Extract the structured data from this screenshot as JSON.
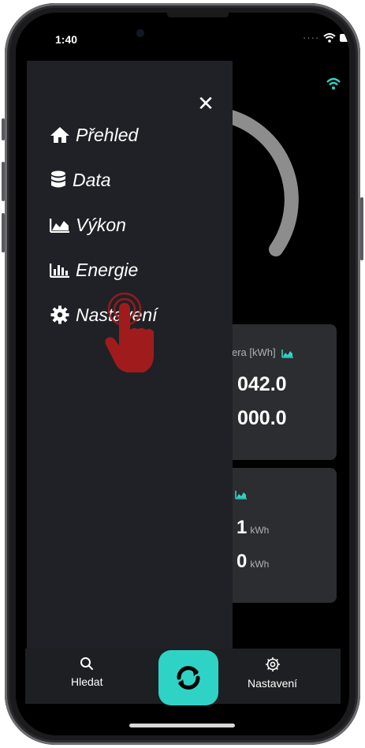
{
  "status_bar": {
    "time": "1:40"
  },
  "menu": {
    "items": [
      {
        "label": "Přehled",
        "icon": "home-icon"
      },
      {
        "label": "Data",
        "icon": "database-icon"
      },
      {
        "label": "Výkon",
        "icon": "area-chart-icon"
      },
      {
        "label": "Energie",
        "icon": "bar-chart-icon"
      },
      {
        "label": "Nastavení",
        "icon": "gear-icon"
      }
    ]
  },
  "cards": {
    "energy": {
      "label": "era [kWh]",
      "value1": "042.0",
      "value2": "000.0"
    },
    "daily": {
      "value1": "1",
      "value2": "0",
      "unit": "kWh"
    }
  },
  "bottom_nav": {
    "search_label": "Hledat",
    "settings_label": "Nastavení"
  },
  "colors": {
    "accent": "#2fd3c5",
    "drawer_bg": "#202127",
    "card_bg": "#2b2d31",
    "tap_hand": "#a01c1c"
  }
}
